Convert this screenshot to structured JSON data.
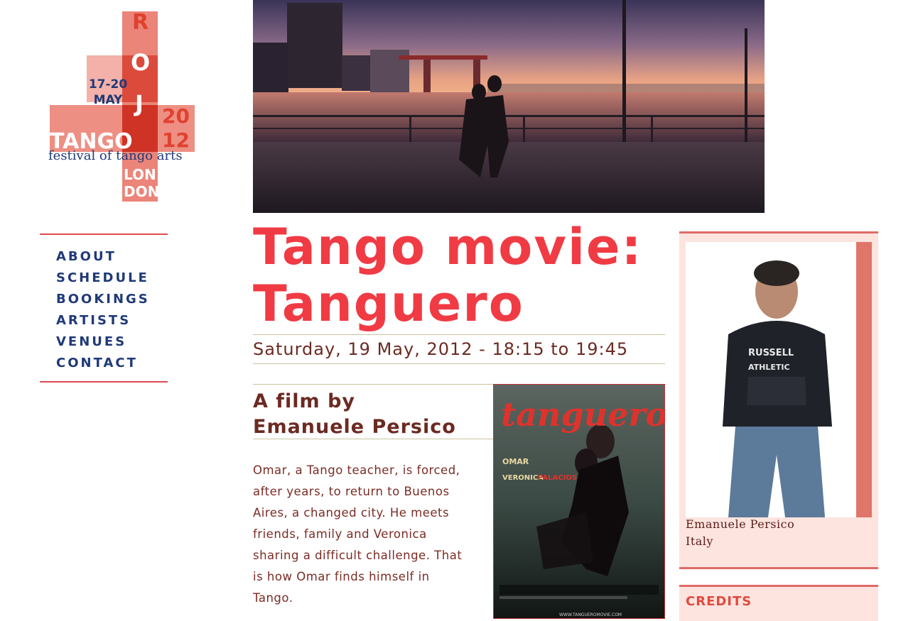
{
  "logo": {
    "date_line1": "17-20",
    "date_line2": "MAY",
    "letter_r": "R",
    "letter_o": "O",
    "letter_j": "J",
    "year_1": "20",
    "year_2": "12",
    "tango": "TANGO",
    "festival": "festival of tango arts",
    "city_1": "LON",
    "city_2": "DON"
  },
  "nav": {
    "items": [
      {
        "label": "ABOUT"
      },
      {
        "label": "SCHEDULE"
      },
      {
        "label": "BOOKINGS"
      },
      {
        "label": "ARTISTS"
      },
      {
        "label": "VENUES"
      },
      {
        "label": "CONTACT"
      }
    ]
  },
  "event": {
    "title_line1": "Tango movie:",
    "title_line2": "Tanguero",
    "date": "Saturday, 19 May, 2012 - 18:15 to 19:45",
    "film_by_line1": "A film by",
    "film_by_line2": "Emanuele Persico",
    "description": "Omar, a Tango teacher, is forced, after years, to return to Buenos Aires, a changed city. He meets friends, family and Veronica sharing a difficult challenge. That is how Omar finds himself in Tango."
  },
  "poster": {
    "title": "tanguero",
    "actor_1_a": "OMAR",
    "actor_2_a": "VERONICA",
    "actor_2_b": "PALACIOS",
    "url": "WWW.TANGUEROMOVIE.COM"
  },
  "artist": {
    "name": "Emanuele Persico",
    "country": "Italy",
    "shirt_line1": "RUSSELL",
    "shirt_line2": "ATHLETIC"
  },
  "sidebar": {
    "credits_label": "CREDITS"
  },
  "colors": {
    "title_red": "#f03b44",
    "nav_blue": "#1f3a78",
    "body_brown": "#7a2c25",
    "panel_pink": "#fde4df",
    "accent_rule": "#e06a66"
  }
}
